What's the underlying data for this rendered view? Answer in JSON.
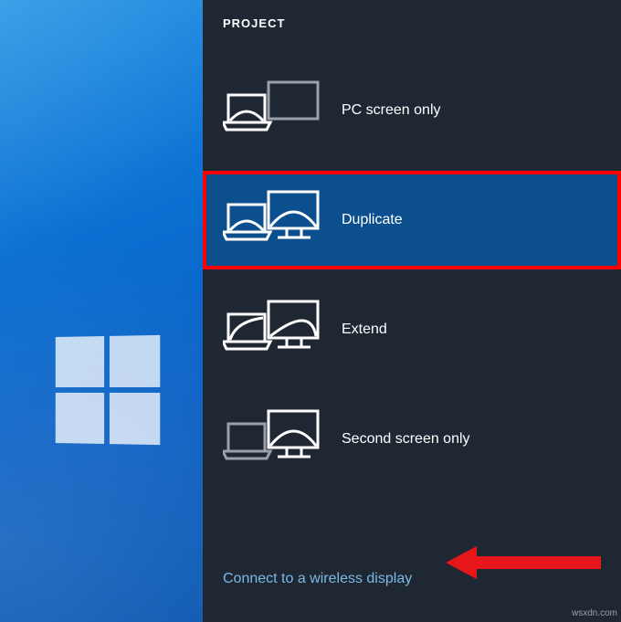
{
  "panel": {
    "title": "PROJECT",
    "options": [
      {
        "key": "pc-screen-only",
        "label": "PC screen only",
        "selected": false
      },
      {
        "key": "duplicate",
        "label": "Duplicate",
        "selected": true
      },
      {
        "key": "extend",
        "label": "Extend",
        "selected": false
      },
      {
        "key": "second-screen-only",
        "label": "Second screen only",
        "selected": false
      }
    ],
    "wireless_link": "Connect to a wireless display"
  },
  "annotation": {
    "highlight_option": "duplicate",
    "arrow_target": "wireless-link"
  },
  "watermark": "wsxdn.com"
}
